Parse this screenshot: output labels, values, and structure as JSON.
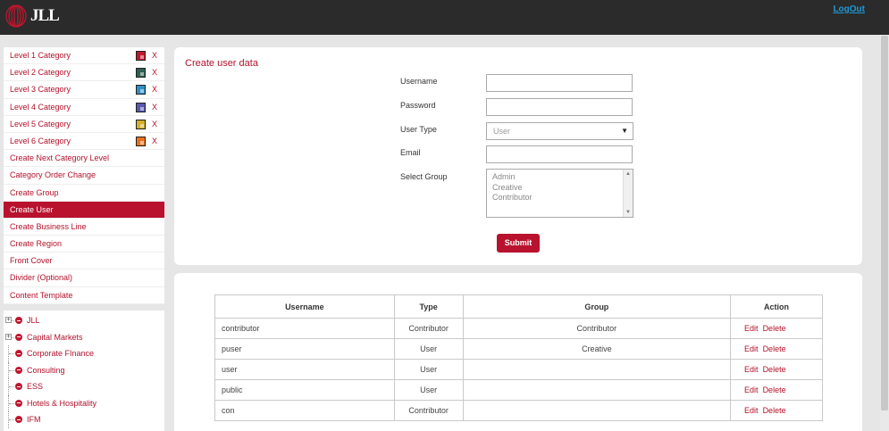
{
  "header": {
    "logo_text": "JLL",
    "logout_label": "LogOut"
  },
  "menu": {
    "items": [
      {
        "label": "Level 1 Category",
        "swatch": "#c0162f",
        "delete": "X"
      },
      {
        "label": "Level 2 Category",
        "swatch": "#2f5f52",
        "delete": "X"
      },
      {
        "label": "Level 3 Category",
        "swatch": "#2f8fc7",
        "delete": "X"
      },
      {
        "label": "Level 4 Category",
        "swatch": "#5a58b0",
        "delete": "X"
      },
      {
        "label": "Level 5 Category",
        "swatch": "#d3b02a",
        "delete": "X"
      },
      {
        "label": "Level 6 Category",
        "swatch": "#e8721c",
        "delete": "X"
      },
      {
        "label": "Create Next Category Level"
      },
      {
        "label": "Category Order Change"
      },
      {
        "label": "Create Group"
      },
      {
        "label": "Create User",
        "active": true
      },
      {
        "label": "Create Business Line"
      },
      {
        "label": "Create Region"
      },
      {
        "label": "Front Cover"
      },
      {
        "label": "Divider (Optional)"
      },
      {
        "label": "Content Template"
      }
    ]
  },
  "tree": {
    "items": [
      {
        "label": "JLL",
        "expandable": true
      },
      {
        "label": "Capital Markets",
        "expandable": true
      },
      {
        "label": "Corporate FInance"
      },
      {
        "label": "Consulting"
      },
      {
        "label": "ESS"
      },
      {
        "label": "Hotels & Hospitality"
      },
      {
        "label": "IFM"
      }
    ]
  },
  "form": {
    "title": "Create user data",
    "username_label": "Username",
    "username_value": "",
    "password_label": "Password",
    "password_value": "",
    "usertype_label": "User Type",
    "usertype_value": "User",
    "email_label": "Email",
    "email_value": "",
    "group_label": "Select Group",
    "group_options": [
      "Admin",
      "Creative",
      "Contributor"
    ],
    "submit_label": "Submit"
  },
  "table": {
    "headers": [
      "Username",
      "Type",
      "Group",
      "Action"
    ],
    "edit_label": "Edit",
    "delete_label": "Delete",
    "rows": [
      {
        "username": "contributor",
        "type": "Contributor",
        "group": "Contributor"
      },
      {
        "username": "puser",
        "type": "User",
        "group": "Creative"
      },
      {
        "username": "user",
        "type": "User",
        "group": ""
      },
      {
        "username": "public",
        "type": "User",
        "group": ""
      },
      {
        "username": "con",
        "type": "Contributor",
        "group": ""
      }
    ]
  },
  "colors": {
    "accent": "#b8122e",
    "header_bg": "#2b2b2b",
    "link": "#1e9ad6"
  }
}
